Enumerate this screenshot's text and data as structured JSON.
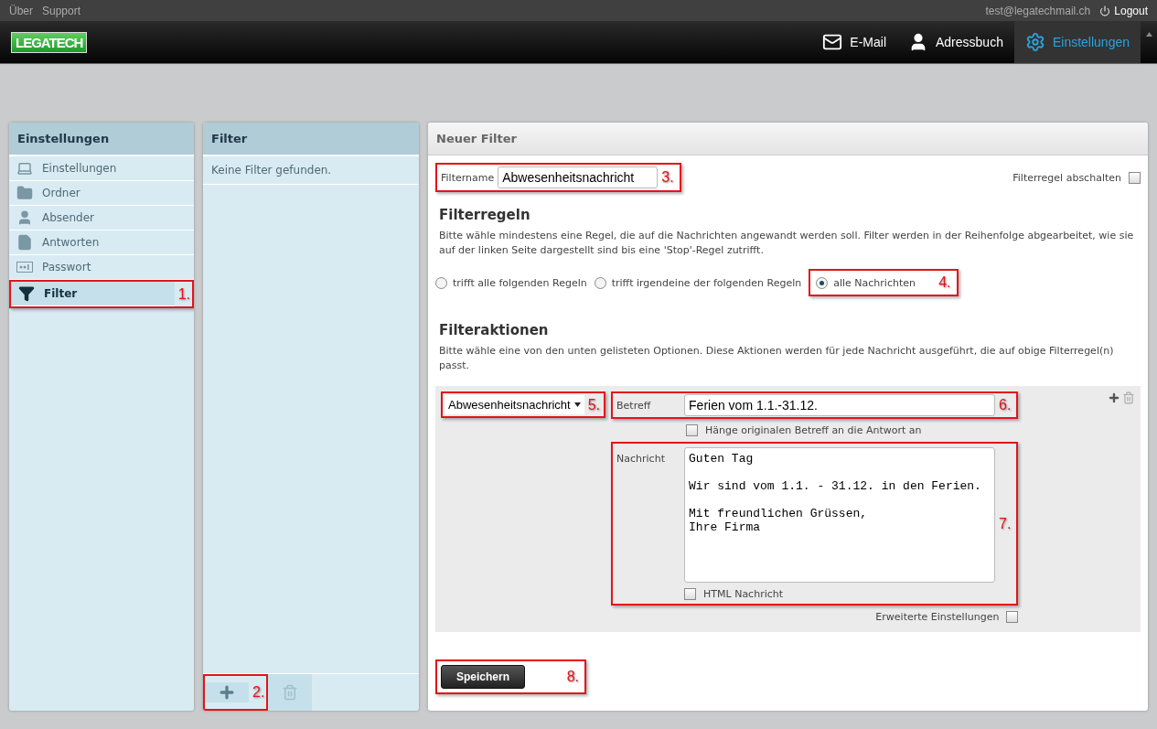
{
  "top_bar": {
    "links": [
      "Über",
      "Support"
    ],
    "email": "test@legatechmail.ch",
    "logout": "Logout"
  },
  "logo": "LEGATECH",
  "nav": [
    {
      "label": "E-Mail",
      "selected": false
    },
    {
      "label": "Adressbuch",
      "selected": false
    },
    {
      "label": "Einstellungen",
      "selected": true
    }
  ],
  "settings_panel": {
    "title": "Einstellungen",
    "items": [
      {
        "label": "Einstellungen",
        "selected": false
      },
      {
        "label": "Ordner",
        "selected": false
      },
      {
        "label": "Absender",
        "selected": false
      },
      {
        "label": "Antworten",
        "selected": false
      },
      {
        "label": "Passwort",
        "selected": false
      },
      {
        "label": "Filter",
        "selected": true,
        "callout": "1."
      }
    ]
  },
  "filter_panel": {
    "title": "Filter",
    "empty": "Keine Filter gefunden.",
    "add_callout": "2."
  },
  "editor": {
    "title": "Neuer Filter",
    "name_label": "Filtername",
    "name_value": "Abwesenheitsnachricht",
    "name_callout": "3.",
    "disable_label": "Filterregel abschalten",
    "disable_checked": false,
    "rules_heading": "Filterregeln",
    "rules_text": "Bitte wähle mindestens eine Regel, die auf die Nachrichten angewandt werden soll. Filter werden in der Reihenfolge abgearbeitet, wie sie auf der linken Seite dargestellt sind bis eine 'Stop'-Regel zutrifft.",
    "rules": [
      {
        "label": "trifft alle folgenden Regeln",
        "selected": false
      },
      {
        "label": "trifft irgendeine der folgenden Regeln",
        "selected": false
      },
      {
        "label": "alle Nachrichten",
        "selected": true,
        "callout": "4."
      }
    ],
    "actions_heading": "Filteraktionen",
    "actions_text": "Bitte wähle eine von den unten gelisteten Optionen. Diese Aktionen werden für jede Nachricht ausgeführt, die auf obige Filterregel(n) passt.",
    "action": {
      "type": "Abwesenheitsnachricht",
      "type_callout": "5.",
      "subject_label": "Betreff",
      "subject_value": "Ferien vom 1.1.-31.12.",
      "subject_callout": "6.",
      "append_label": "Hänge originalen Betreff an die Antwort an",
      "append_checked": false,
      "message_label": "Nachricht",
      "message_value": "Guten Tag\n\nWir sind vom 1.1. - 31.12. in den Ferien.\n\nMit freundlichen Grüssen,\nIhre Firma",
      "message_callout": "7.",
      "html_label": "HTML Nachricht",
      "html_checked": false,
      "advanced_label": "Erweiterte Einstellungen",
      "advanced_checked": false
    },
    "save_label": "Speichern",
    "save_callout": "8."
  }
}
